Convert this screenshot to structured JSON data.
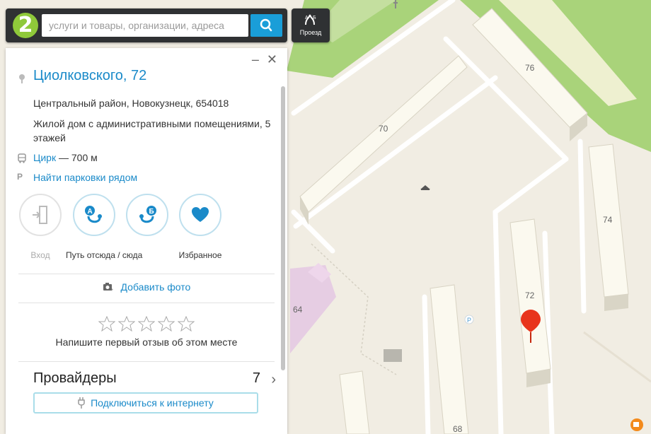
{
  "search": {
    "placeholder": "услуги и товары, организации, адреса"
  },
  "route": {
    "label": "Проезд"
  },
  "card": {
    "controls": {
      "minimize": "–",
      "close": "✕"
    },
    "title": "Циолковского, 72",
    "district": "Центральный район, Новокузнецк, 654018",
    "description": "Жилой дом с административными помещениями, 5 этажей",
    "transit": {
      "stop": "Цирк",
      "distance": "— 700 м"
    },
    "parking": {
      "icon_label": "P",
      "link": "Найти парковки рядом"
    },
    "actions": [
      {
        "label": "Вход"
      },
      {
        "label": "Путь отсюда / сюда"
      },
      {
        "label": "Избранное"
      }
    ],
    "add_photo": "Добавить фото",
    "review_prompt": "Напишите первый отзыв об этом месте",
    "providers": {
      "title": "Провайдеры",
      "count": "7",
      "connect": "Подключиться к интернету"
    }
  },
  "map": {
    "house_numbers": [
      "76",
      "70",
      "74",
      "72",
      "64",
      "68"
    ],
    "parking_label": "P"
  },
  "colors": {
    "accent": "#1a8ac9",
    "marker": "#e8341c",
    "park": "#a9d37a",
    "road": "#ffffff",
    "ground": "#f1ede3"
  }
}
